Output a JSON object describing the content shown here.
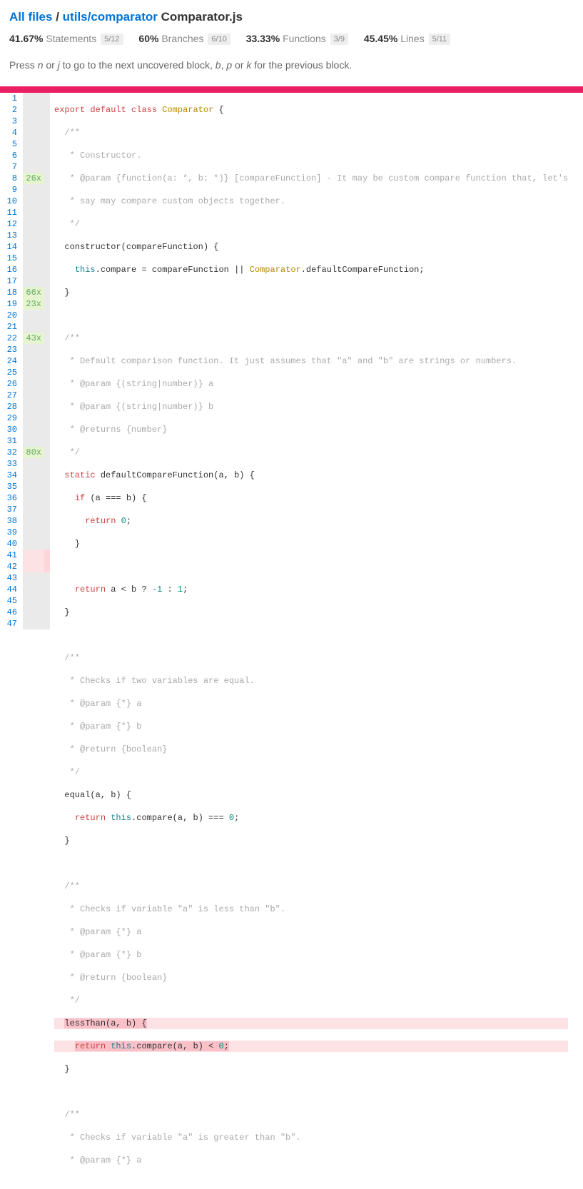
{
  "breadcrumb": {
    "root": "All files",
    "path": "utils/comparator",
    "file": "Comparator.js",
    "sep": "/"
  },
  "metrics": {
    "statements": {
      "pct": "41.67%",
      "label": "Statements",
      "frac": "5/12"
    },
    "branches": {
      "pct": "60%",
      "label": "Branches",
      "frac": "6/10"
    },
    "functions": {
      "pct": "33.33%",
      "label": "Functions",
      "frac": "3/9"
    },
    "lines": {
      "pct": "45.45%",
      "label": "Lines",
      "frac": "5/11"
    }
  },
  "hint": {
    "prefix": "Press ",
    "k1": "n",
    "or1": " or ",
    "k2": "j",
    "mid": " to go to the next uncovered block, ",
    "k3": "b",
    "c1": ", ",
    "k4": "p",
    "or2": " or ",
    "k5": "k",
    "suffix": " for the previous block."
  },
  "hits": {
    "l8": "26x",
    "l18": "66x",
    "l19": "23x",
    "l22": "43x",
    "l32": "80x"
  },
  "tokens": {
    "export": "export",
    "default": "default",
    "class": "class",
    "Comparator": "Comparator",
    "constructor": "constructor",
    "this": "this",
    "compare": "compare",
    "compareFunction": "compareFunction",
    "defaultCompareFunction": "defaultCompareFunction",
    "static": "static",
    "if": "if",
    "return": "return",
    "equal": "equal",
    "lessThan": "lessThan",
    "n0": "0",
    "nneg1": "-1",
    "n1": "1"
  },
  "comments": {
    "blk_open": "/**",
    "blk_close": " */",
    "constructorTitle": " * Constructor.",
    "constructorParam": " * @param {function(a: *, b: *)} [compareFunction] - It may be custom compare function that, let's",
    "constructorParam2": " * say may compare custom objects together.",
    "defaultTitle": " * Default comparison function. It just assumes that \"a\" and \"b\" are strings or numbers.",
    "defaultPA": " * @param {(string|number)} a",
    "defaultPB": " * @param {(string|number)} b",
    "defaultRet": " * @returns {number}",
    "equalTitle": " * Checks if two variables are equal.",
    "paramA": " * @param {*} a",
    "paramB": " * @param {*} b",
    "retBool": " * @return {boolean}",
    "lessTitle": " * Checks if variable \"a\" is less than \"b\".",
    "greaterTitle": " * Checks if variable \"a\" is greater than \"b\".",
    "paramA_cut": " * @param {*} a"
  },
  "total_lines": 47
}
